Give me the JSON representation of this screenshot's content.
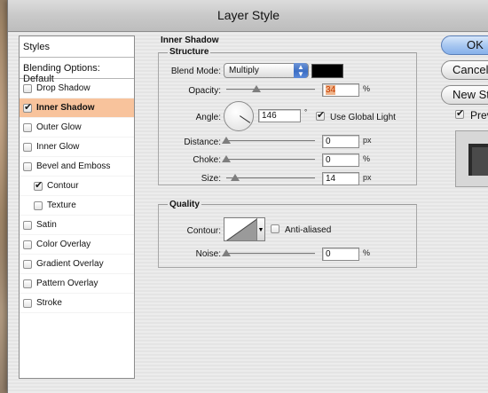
{
  "window": {
    "title": "Layer Style"
  },
  "styles_list": {
    "header": "Styles",
    "blending_options": "Blending Options: Default",
    "items": [
      {
        "label": "Drop Shadow",
        "checked": false,
        "selected": false,
        "indent": false
      },
      {
        "label": "Inner Shadow",
        "checked": true,
        "selected": true,
        "indent": false
      },
      {
        "label": "Outer Glow",
        "checked": false,
        "selected": false,
        "indent": false
      },
      {
        "label": "Inner Glow",
        "checked": false,
        "selected": false,
        "indent": false
      },
      {
        "label": "Bevel and Emboss",
        "checked": false,
        "selected": false,
        "indent": false
      },
      {
        "label": "Contour",
        "checked": true,
        "selected": false,
        "indent": true
      },
      {
        "label": "Texture",
        "checked": false,
        "selected": false,
        "indent": true
      },
      {
        "label": "Satin",
        "checked": false,
        "selected": false,
        "indent": false
      },
      {
        "label": "Color Overlay",
        "checked": false,
        "selected": false,
        "indent": false
      },
      {
        "label": "Gradient Overlay",
        "checked": false,
        "selected": false,
        "indent": false
      },
      {
        "label": "Pattern Overlay",
        "checked": false,
        "selected": false,
        "indent": false
      },
      {
        "label": "Stroke",
        "checked": false,
        "selected": false,
        "indent": false
      }
    ]
  },
  "inner_shadow": {
    "section_title": "Inner Shadow",
    "structure": {
      "title": "Structure",
      "blend_mode_label": "Blend Mode:",
      "blend_mode_value": "Multiply",
      "color": "#000000",
      "opacity_label": "Opacity:",
      "opacity_value": "34",
      "opacity_fraction": 0.34,
      "opacity_unit": "%",
      "angle_label": "Angle:",
      "angle_value": "146",
      "angle_unit": "°",
      "use_global_light_label": "Use Global Light",
      "use_global_light_checked": true,
      "distance_label": "Distance:",
      "distance_value": "0",
      "distance_unit": "px",
      "choke_label": "Choke:",
      "choke_value": "0",
      "choke_unit": "%",
      "size_label": "Size:",
      "size_value": "14",
      "size_unit": "px"
    },
    "quality": {
      "title": "Quality",
      "contour_label": "Contour:",
      "anti_aliased_label": "Anti-aliased",
      "anti_aliased_checked": false,
      "noise_label": "Noise:",
      "noise_value": "0",
      "noise_unit": "%"
    }
  },
  "buttons": {
    "ok": "OK",
    "cancel": "Cancel",
    "new_style": "New Style...",
    "preview": "Preview",
    "preview_checked": true
  }
}
